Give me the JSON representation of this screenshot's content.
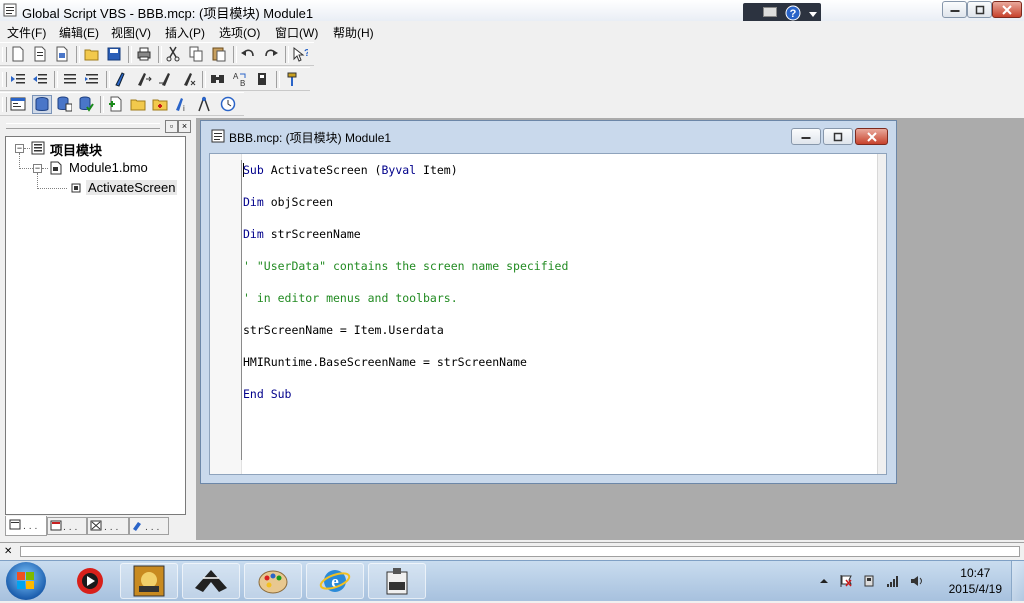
{
  "window": {
    "title": "Global Script VBS - BBB.mcp: (项目模块) Module1"
  },
  "menu": {
    "items": [
      "文件(F)",
      "编辑(E)",
      "视图(V)",
      "插入(P)",
      "选项(O)",
      "窗口(W)",
      "帮助(H)"
    ]
  },
  "tree": {
    "root": "项目模块",
    "module": "Module1.bmo",
    "procedure": "ActivateScreen"
  },
  "child_window": {
    "title": "BBB.mcp: (项目模块) Module1"
  },
  "code": {
    "line1_kw": "Sub",
    "line1_a": " ActivateScreen (",
    "line1_kw2": "Byval",
    "line1_b": " Item)",
    "line2_kw": "Dim",
    "line2_rest": " objScreen",
    "line3_kw": "Dim",
    "line3_rest": " strScreenName",
    "line4": "' \"UserData\" contains the screen name specified",
    "line5": "' in editor menus and toolbars.",
    "line6": "strScreenName = Item.Userdata",
    "line7": "HMIRuntime.BaseScreenName = strScreenName",
    "line8_kw": "End Sub"
  },
  "taskbar": {
    "time": "10:47",
    "date": "2015/4/19"
  },
  "colors": {
    "keyword": "#00008b",
    "comment": "#228b22"
  }
}
